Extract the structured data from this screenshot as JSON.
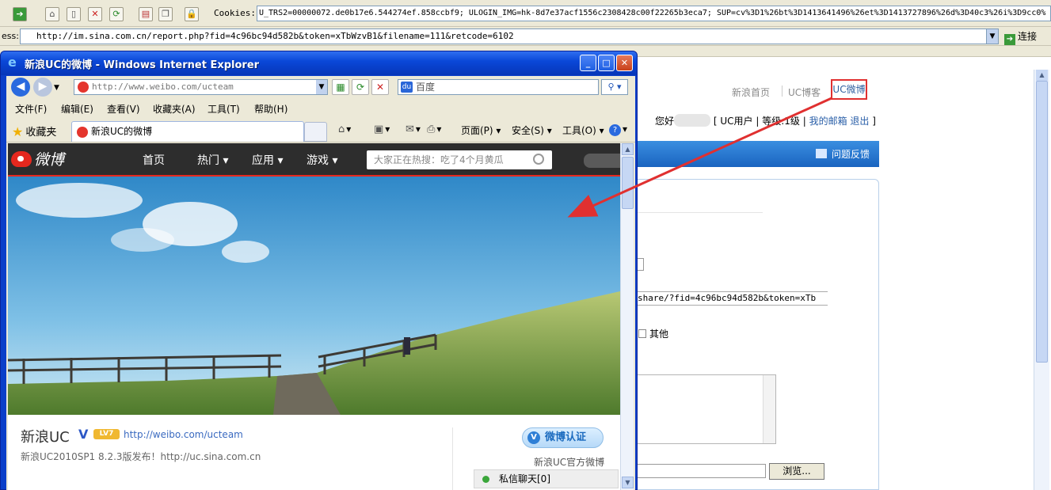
{
  "background": {
    "cookies_label": "Cookies:",
    "cookies_value": "U_TRS2=00000072.de0b17e6.544274ef.858ccbf9; ULOGIN_IMG=hk-8d7e37acf1556c2308428c00f22265b3eca7; SUP=cv%3D1%26bt%3D1413641496%26et%3D1413727896%26d%3D40c3%26i%3D9cc0%",
    "address_label": "ess:",
    "address_url": "http://im.sina.com.cn/report.php?fid=4c96bc94d582b&token=xTbWzvB1&filename=111&retcode=6102",
    "go_label": "连接",
    "nav": {
      "home": "新浪首页",
      "uc_blog": "UC博客",
      "uc_weibo": "UC微博"
    },
    "user_row": {
      "greeting": "您好",
      "user_type": "[ UC用户 |",
      "level": "等级:1级",
      "mailbox": "我的邮箱",
      "logout": "退出",
      "close_bracket": "]"
    },
    "feedback": "问题反馈",
    "share_url_fragment": "share/?fid=4c96bc94d582b&token=xTb",
    "other_checkbox_label": "其他",
    "browse_button": "浏览..."
  },
  "popup": {
    "title": "新浪UC的微博 - Windows Internet Explorer",
    "address_url": "http://www.weibo.com/ucteam",
    "search_placeholder": "百度",
    "menu": [
      "文件(F)",
      "编辑(E)",
      "查看(V)",
      "收藏夹(A)",
      "工具(T)",
      "帮助(H)"
    ],
    "favorites_label": "收藏夹",
    "tab_title": "新浪UC的微博",
    "commands": {
      "page": "页面(P)",
      "safety": "安全(S)",
      "tools": "工具(O)"
    }
  },
  "weibo": {
    "logo_text": "微博",
    "nav": [
      "首页",
      "热门",
      "应用",
      "游戏"
    ],
    "search_placeholder": "大家正在热搜：吃了4个月黄瓜",
    "profile": {
      "name": "新浪UC",
      "level_badge": "LV7",
      "url": "http://weibo.com/ucteam",
      "description": "新浪UC2010SP1 8.2.3版发布！http://uc.sina.com.cn",
      "verified_badge": "微博认证",
      "verified_caption": "新浪UC官方微博",
      "chat": "私信聊天[0]"
    }
  },
  "colors": {
    "popup_titlebar": "#0a48d8",
    "weibo_header": "#2d2d2d",
    "weibo_red": "#e5281e",
    "annotation_red": "#e03030",
    "link_blue": "#2a5fa8"
  }
}
